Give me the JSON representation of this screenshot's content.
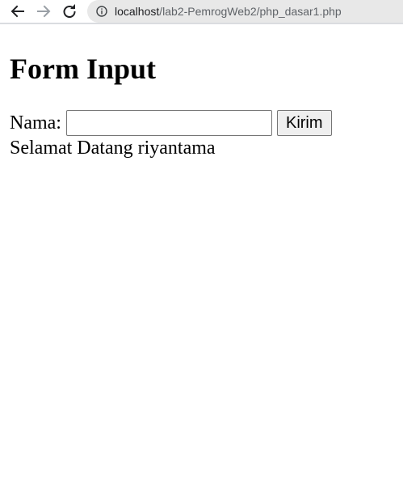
{
  "browser": {
    "url_host": "localhost",
    "url_path": "/lab2-PemrogWeb2/php_dasar1.php"
  },
  "page": {
    "heading": "Form Input",
    "form": {
      "label": "Nama:",
      "input_value": "",
      "submit_label": "Kirim"
    },
    "welcome_text": "Selamat Datang riyantama"
  }
}
